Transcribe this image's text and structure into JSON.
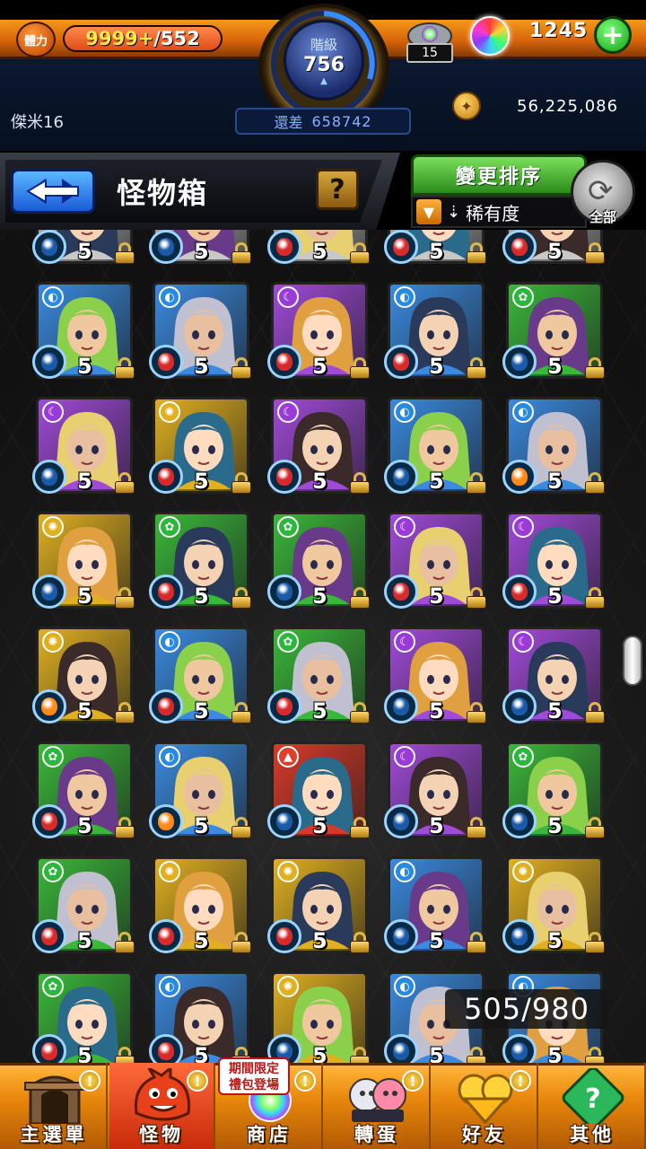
{
  "header": {
    "stamina_label": "體力",
    "stamina_current": "9999+",
    "stamina_max": "/552",
    "rank_label": "階級",
    "rank_value": "756",
    "exp_label": "還差",
    "exp_remaining": "658742",
    "orb_capsule_count": "15",
    "orb_total": "1245",
    "player_name": "傑米16",
    "gold": "56,225,086"
  },
  "title_bar": {
    "title": "怪物箱",
    "help_label": "?",
    "sort_button": "變更排序",
    "sort_mode": "稀有度",
    "all_label": "全部"
  },
  "box_count": "505/980",
  "bottom_nav": {
    "items": [
      {
        "label": "主選單",
        "icon": "gate-icon",
        "alert": "!"
      },
      {
        "label": "怪物",
        "icon": "monster-icon",
        "alert": "!"
      },
      {
        "label": "商店",
        "icon": "orb-shop-icon",
        "alert": "!"
      },
      {
        "label": "轉蛋",
        "icon": "gacha-icon",
        "alert": "!"
      },
      {
        "label": "好友",
        "icon": "friends-icon",
        "alert": "!"
      },
      {
        "label": "其他",
        "icon": "other-icon",
        "alert": ""
      }
    ],
    "promo_badge": "期間限定\n禮包登場"
  },
  "monsters": [
    {
      "attr": "fire",
      "orb": "blue",
      "stars": "5",
      "frame": "#c8c8c8"
    },
    {
      "attr": "water",
      "orb": "blue",
      "stars": "5",
      "frame": "#c8c8c8"
    },
    {
      "attr": "fire",
      "orb": "red",
      "stars": "5",
      "frame": "#c8c8c8"
    },
    {
      "attr": "water",
      "orb": "red",
      "stars": "5",
      "frame": "#c8c8c8"
    },
    {
      "attr": "fire",
      "orb": "red",
      "stars": "5",
      "frame": "#c8c8c8"
    },
    {
      "attr": "water",
      "orb": "blue",
      "stars": "5",
      "frame": "#3a8ae0"
    },
    {
      "attr": "water",
      "orb": "red",
      "stars": "5",
      "frame": "#3a8ae0"
    },
    {
      "attr": "dark",
      "orb": "red",
      "stars": "5",
      "frame": "#a04ad8"
    },
    {
      "attr": "water",
      "orb": "red",
      "stars": "5",
      "frame": "#3a8ae0"
    },
    {
      "attr": "wood",
      "orb": "blue",
      "stars": "5",
      "frame": "#3ab83a"
    },
    {
      "attr": "dark",
      "orb": "blue",
      "stars": "5",
      "frame": "#a04ad8"
    },
    {
      "attr": "light",
      "orb": "red",
      "stars": "5",
      "frame": "#e0b020"
    },
    {
      "attr": "dark",
      "orb": "red",
      "stars": "5",
      "frame": "#a04ad8"
    },
    {
      "attr": "water",
      "orb": "blue",
      "stars": "5",
      "frame": "#3a8ae0"
    },
    {
      "attr": "water",
      "orb": "fire",
      "stars": "5",
      "frame": "#3a8ae0"
    },
    {
      "attr": "light",
      "orb": "blue",
      "stars": "5",
      "frame": "#e0b020"
    },
    {
      "attr": "wood",
      "orb": "red",
      "stars": "5",
      "frame": "#3ab83a"
    },
    {
      "attr": "wood",
      "orb": "blue",
      "stars": "5",
      "frame": "#3ab83a"
    },
    {
      "attr": "dark",
      "orb": "red",
      "stars": "5",
      "frame": "#a04ad8"
    },
    {
      "attr": "dark",
      "orb": "red",
      "stars": "5",
      "frame": "#a04ad8"
    },
    {
      "attr": "light",
      "orb": "fire",
      "stars": "5",
      "frame": "#e0b020"
    },
    {
      "attr": "water",
      "orb": "red",
      "stars": "5",
      "frame": "#3a8ae0"
    },
    {
      "attr": "wood",
      "orb": "red",
      "stars": "5",
      "frame": "#3ab83a"
    },
    {
      "attr": "dark",
      "orb": "blue",
      "stars": "5",
      "frame": "#a04ad8"
    },
    {
      "attr": "dark",
      "orb": "blue",
      "stars": "5",
      "frame": "#a04ad8"
    },
    {
      "attr": "wood",
      "orb": "red",
      "stars": "5",
      "frame": "#3ab83a"
    },
    {
      "attr": "water",
      "orb": "fire",
      "stars": "5",
      "frame": "#3a8ae0"
    },
    {
      "attr": "fire",
      "orb": "blue",
      "stars": "5",
      "frame": "#d83a2a"
    },
    {
      "attr": "dark",
      "orb": "blue",
      "stars": "5",
      "frame": "#a04ad8"
    },
    {
      "attr": "wood",
      "orb": "blue",
      "stars": "5",
      "frame": "#3ab83a"
    },
    {
      "attr": "wood",
      "orb": "red",
      "stars": "5",
      "frame": "#3ab83a"
    },
    {
      "attr": "light",
      "orb": "red",
      "stars": "5",
      "frame": "#e0b020"
    },
    {
      "attr": "light",
      "orb": "red",
      "stars": "5",
      "frame": "#e0b020"
    },
    {
      "attr": "water",
      "orb": "blue",
      "stars": "5",
      "frame": "#3a8ae0"
    },
    {
      "attr": "light",
      "orb": "blue",
      "stars": "5",
      "frame": "#e0b020"
    },
    {
      "attr": "wood",
      "orb": "red",
      "stars": "5",
      "frame": "#3ab83a"
    },
    {
      "attr": "water",
      "orb": "red",
      "stars": "5",
      "frame": "#3a8ae0"
    },
    {
      "attr": "light",
      "orb": "blue",
      "stars": "5",
      "frame": "#e0b020"
    },
    {
      "attr": "water",
      "orb": "blue",
      "stars": "5",
      "frame": "#3a8ae0"
    },
    {
      "attr": "water",
      "orb": "blue",
      "stars": "5",
      "frame": "#3a8ae0"
    }
  ],
  "colors": {
    "fire": "#e0402a",
    "water": "#2a8ae0",
    "wood": "#2ab83a",
    "light": "#e0b020",
    "dark": "#9a3ad8",
    "orb_blue": "#1a5aa8",
    "orb_red": "#d82a2a",
    "orb_fire": "#ff8a1a"
  }
}
